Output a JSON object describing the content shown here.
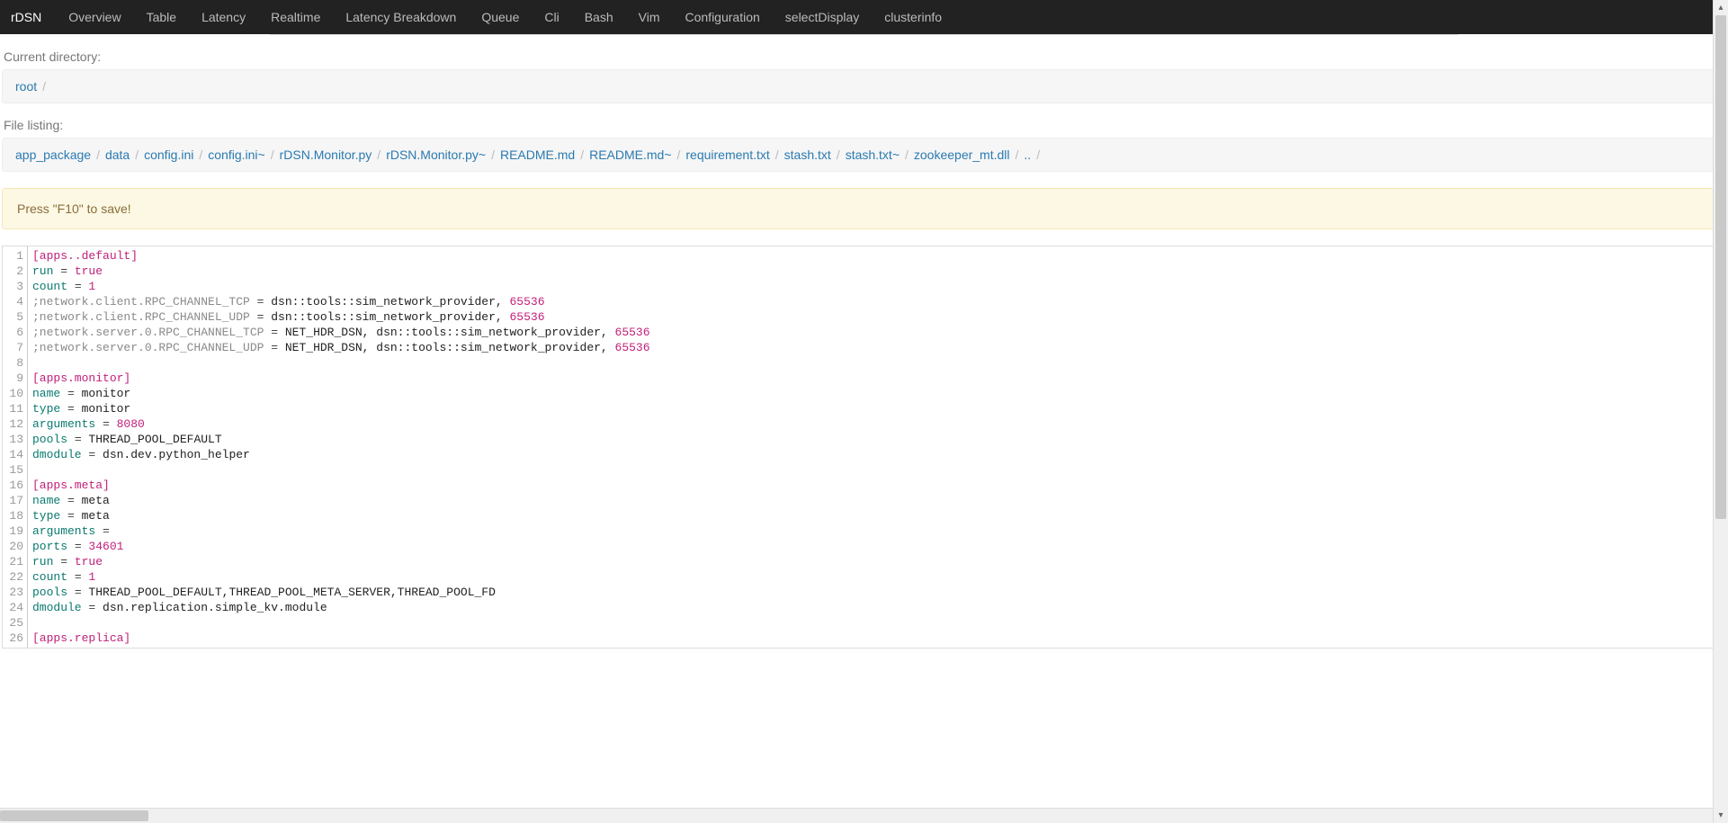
{
  "nav": {
    "brand": "rDSN",
    "items": [
      "Overview",
      "Table",
      "Latency",
      "Realtime",
      "Latency Breakdown",
      "Queue",
      "Cli",
      "Bash",
      "Vim",
      "Configuration",
      "selectDisplay",
      "clusterinfo"
    ]
  },
  "dirLabel": "Current directory:",
  "dirCrumbs": [
    "root"
  ],
  "fileLabel": "File listing:",
  "fileCrumbs": [
    "app_package",
    "data",
    "config.ini",
    "config.ini~",
    "rDSN.Monitor.py",
    "rDSN.Monitor.py~",
    "README.md",
    "README.md~",
    "requirement.txt",
    "stash.txt",
    "stash.txt~",
    "zookeeper_mt.dll",
    ".."
  ],
  "alert": "Press \"F10\" to save!",
  "editor": {
    "lines": [
      {
        "n": 1,
        "seg": [
          {
            "c": "tok-section",
            "t": "[apps..default]"
          }
        ]
      },
      {
        "n": 2,
        "seg": [
          {
            "c": "tok-key",
            "t": "run"
          },
          {
            "c": "tok-eq",
            "t": " = "
          },
          {
            "c": "tok-bool",
            "t": "true"
          }
        ]
      },
      {
        "n": 3,
        "seg": [
          {
            "c": "tok-key",
            "t": "count"
          },
          {
            "c": "tok-eq",
            "t": " = "
          },
          {
            "c": "tok-num",
            "t": "1"
          }
        ]
      },
      {
        "n": 4,
        "seg": [
          {
            "c": "tok-keygray",
            "t": ";network.client.RPC_CHANNEL_TCP"
          },
          {
            "c": "tok-eq",
            "t": " = "
          },
          {
            "c": "tok-plain",
            "t": "dsn::tools::sim_network_provider, "
          },
          {
            "c": "tok-num",
            "t": "65536"
          }
        ]
      },
      {
        "n": 5,
        "seg": [
          {
            "c": "tok-keygray",
            "t": ";network.client.RPC_CHANNEL_UDP"
          },
          {
            "c": "tok-eq",
            "t": " = "
          },
          {
            "c": "tok-plain",
            "t": "dsn::tools::sim_network_provider, "
          },
          {
            "c": "tok-num",
            "t": "65536"
          }
        ]
      },
      {
        "n": 6,
        "seg": [
          {
            "c": "tok-keygray",
            "t": ";network.server.0.RPC_CHANNEL_TCP"
          },
          {
            "c": "tok-eq",
            "t": " = "
          },
          {
            "c": "tok-plain",
            "t": "NET_HDR_DSN, dsn::tools::sim_network_provider, "
          },
          {
            "c": "tok-num",
            "t": "65536"
          }
        ]
      },
      {
        "n": 7,
        "seg": [
          {
            "c": "tok-keygray",
            "t": ";network.server.0.RPC_CHANNEL_UDP"
          },
          {
            "c": "tok-eq",
            "t": " = "
          },
          {
            "c": "tok-plain",
            "t": "NET_HDR_DSN, dsn::tools::sim_network_provider, "
          },
          {
            "c": "tok-num",
            "t": "65536"
          }
        ]
      },
      {
        "n": 8,
        "seg": []
      },
      {
        "n": 9,
        "seg": [
          {
            "c": "tok-section",
            "t": "[apps.monitor]"
          }
        ]
      },
      {
        "n": 10,
        "seg": [
          {
            "c": "tok-key",
            "t": "name"
          },
          {
            "c": "tok-eq",
            "t": " = "
          },
          {
            "c": "tok-plain",
            "t": "monitor"
          }
        ]
      },
      {
        "n": 11,
        "seg": [
          {
            "c": "tok-key",
            "t": "type"
          },
          {
            "c": "tok-eq",
            "t": " = "
          },
          {
            "c": "tok-plain",
            "t": "monitor"
          }
        ]
      },
      {
        "n": 12,
        "seg": [
          {
            "c": "tok-key",
            "t": "arguments"
          },
          {
            "c": "tok-eq",
            "t": " = "
          },
          {
            "c": "tok-num",
            "t": "8080"
          }
        ]
      },
      {
        "n": 13,
        "seg": [
          {
            "c": "tok-key",
            "t": "pools"
          },
          {
            "c": "tok-eq",
            "t": " = "
          },
          {
            "c": "tok-plain",
            "t": "THREAD_POOL_DEFAULT"
          }
        ]
      },
      {
        "n": 14,
        "seg": [
          {
            "c": "tok-key",
            "t": "dmodule"
          },
          {
            "c": "tok-eq",
            "t": " = "
          },
          {
            "c": "tok-plain",
            "t": "dsn.dev.python_helper"
          }
        ]
      },
      {
        "n": 15,
        "seg": []
      },
      {
        "n": 16,
        "seg": [
          {
            "c": "tok-section",
            "t": "[apps.meta]"
          }
        ]
      },
      {
        "n": 17,
        "seg": [
          {
            "c": "tok-key",
            "t": "name"
          },
          {
            "c": "tok-eq",
            "t": " = "
          },
          {
            "c": "tok-plain",
            "t": "meta"
          }
        ]
      },
      {
        "n": 18,
        "seg": [
          {
            "c": "tok-key",
            "t": "type"
          },
          {
            "c": "tok-eq",
            "t": " = "
          },
          {
            "c": "tok-plain",
            "t": "meta"
          }
        ]
      },
      {
        "n": 19,
        "seg": [
          {
            "c": "tok-key",
            "t": "arguments"
          },
          {
            "c": "tok-eq",
            "t": " = "
          }
        ]
      },
      {
        "n": 20,
        "seg": [
          {
            "c": "tok-key",
            "t": "ports"
          },
          {
            "c": "tok-eq",
            "t": " = "
          },
          {
            "c": "tok-num",
            "t": "34601"
          }
        ]
      },
      {
        "n": 21,
        "seg": [
          {
            "c": "tok-key",
            "t": "run"
          },
          {
            "c": "tok-eq",
            "t": " = "
          },
          {
            "c": "tok-bool",
            "t": "true"
          }
        ]
      },
      {
        "n": 22,
        "seg": [
          {
            "c": "tok-key",
            "t": "count"
          },
          {
            "c": "tok-eq",
            "t": " = "
          },
          {
            "c": "tok-num",
            "t": "1"
          }
        ]
      },
      {
        "n": 23,
        "seg": [
          {
            "c": "tok-key",
            "t": "pools"
          },
          {
            "c": "tok-eq",
            "t": " = "
          },
          {
            "c": "tok-plain",
            "t": "THREAD_POOL_DEFAULT,THREAD_POOL_META_SERVER,THREAD_POOL_FD"
          }
        ]
      },
      {
        "n": 24,
        "seg": [
          {
            "c": "tok-key",
            "t": "dmodule"
          },
          {
            "c": "tok-eq",
            "t": " = "
          },
          {
            "c": "tok-plain",
            "t": "dsn.replication.simple_kv.module"
          }
        ]
      },
      {
        "n": 25,
        "seg": []
      },
      {
        "n": 26,
        "seg": [
          {
            "c": "tok-section",
            "t": "[apps.replica]"
          }
        ]
      }
    ]
  }
}
